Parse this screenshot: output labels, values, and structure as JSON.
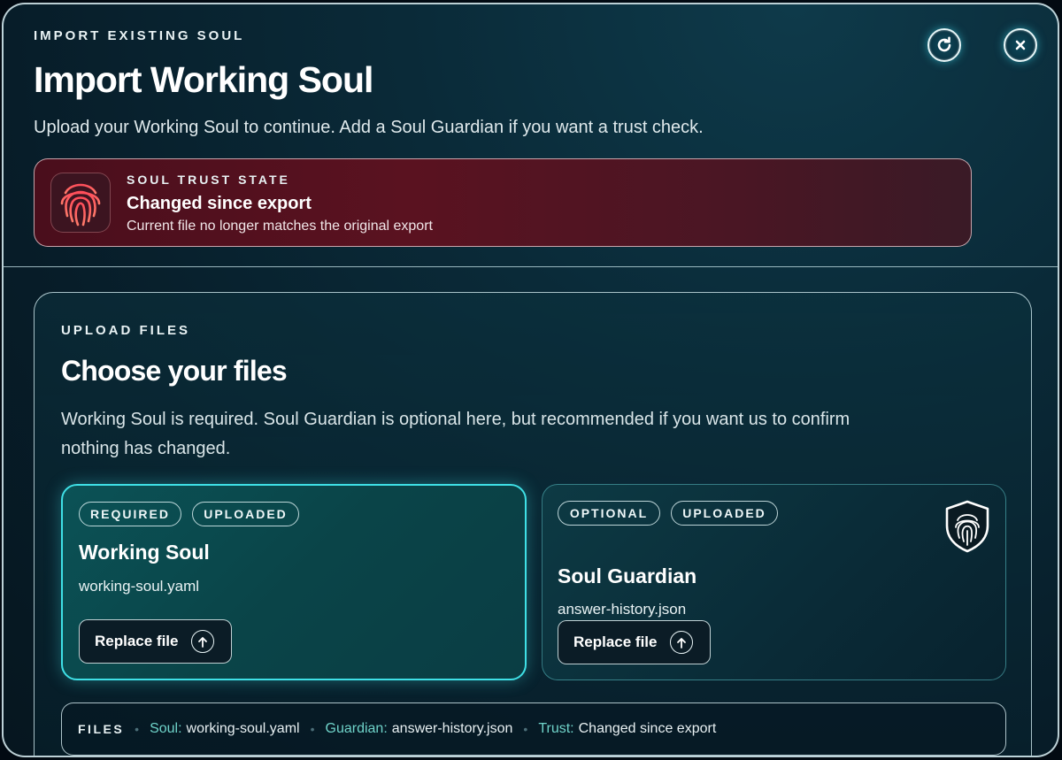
{
  "header": {
    "eyebrow": "IMPORT EXISTING SOUL",
    "title": "Import Working Soul",
    "subtitle": "Upload your Working Soul to continue. Add a Soul Guardian if you want a trust check.",
    "refresh_icon": "refresh-icon",
    "close_icon": "close-icon"
  },
  "trust": {
    "eyebrow": "SOUL TRUST STATE",
    "title": "Changed since export",
    "description": "Current file no longer matches the original export",
    "icon": "fingerprint-icon",
    "color": "#e0465a"
  },
  "upload": {
    "eyebrow": "UPLOAD FILES",
    "title": "Choose your files",
    "description": "Working Soul is required. Soul Guardian is optional here, but recommended if you want us to confirm nothing has changed.",
    "cards": {
      "soul": {
        "badge_1": "REQUIRED",
        "badge_2": "UPLOADED",
        "title": "Working Soul",
        "file": "working-soul.yaml",
        "button": "Replace file",
        "accent": "#3fe0e6"
      },
      "guardian": {
        "badge_1": "OPTIONAL",
        "badge_2": "UPLOADED",
        "title": "Soul Guardian",
        "file": "answer-history.json",
        "button": "Replace file",
        "icon": "shield-fingerprint-icon"
      }
    },
    "files_bar": {
      "label": "FILES",
      "soul_key": "Soul:",
      "soul_val": "working-soul.yaml",
      "guardian_key": "Guardian:",
      "guardian_val": "answer-history.json",
      "trust_key": "Trust:",
      "trust_val": "Changed since export"
    }
  }
}
